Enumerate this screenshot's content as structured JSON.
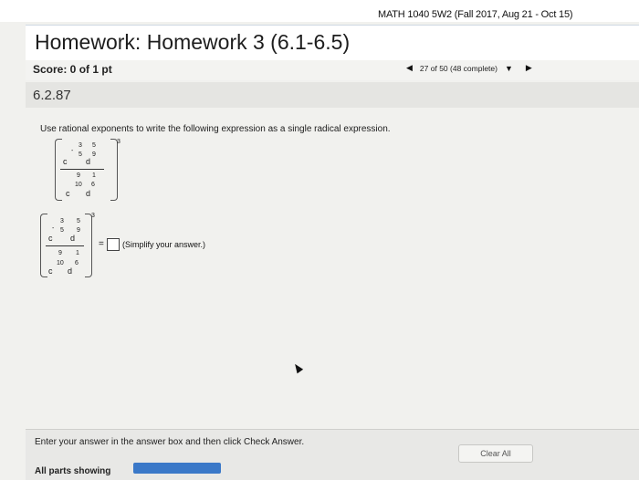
{
  "header": {
    "course": "MATH 1040 5W2 (Fall 2017, Aug 21 - Oct 15)",
    "title": "Homework: Homework 3 (6.1-6.5)"
  },
  "score": {
    "label": "Score: 0 of 1 pt"
  },
  "pager": {
    "text": "27 of 50 (48 complete)",
    "prev_icon": "triangle-left",
    "next_icon": "triangle-right",
    "dropdown_icon": "triangle-down"
  },
  "question": {
    "id": "6.2.87",
    "instruction": "Use rational exponents to write the following expression as a single radical expression.",
    "expr": {
      "num_base1": "c",
      "num_exp1_sign": "-",
      "num_exp1_n": "3",
      "num_exp1_d": "5",
      "num_base2": "d",
      "num_exp2_n": "5",
      "num_exp2_d": "9",
      "den_base1": "c",
      "den_exp1_n": "9",
      "den_exp1_d": "10",
      "den_base2": "d",
      "den_exp2_n": "1",
      "den_exp2_d": "6",
      "outer_exp": "3"
    },
    "equals": "=",
    "hint": "(Simplify your answer.)"
  },
  "footer": {
    "instruction": "Enter your answer in the answer box and then click Check Answer.",
    "clear_label": "Clear All",
    "parts_label": "All parts showing",
    "accent": "#3a78c8"
  }
}
